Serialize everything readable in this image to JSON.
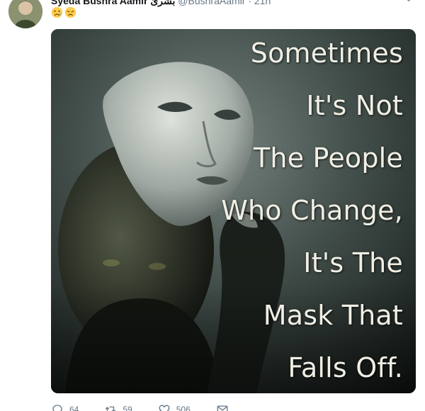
{
  "tweet": {
    "display_name": "Syeda Bushra Aamir بشریٰ",
    "handle": "@BushraAamir",
    "separator": "·",
    "time": "21h",
    "emojis": [
      "crying-face-emoji",
      "disappointed-face-emoji"
    ],
    "image_text": [
      "Sometimes",
      "It's Not",
      "The People",
      "Who Change,",
      "It's The",
      "Mask That",
      "Falls Off."
    ],
    "actions": {
      "replies": "64",
      "retweets": "59",
      "likes": "506"
    }
  },
  "colors": {
    "name": "#14171a",
    "secondary": "#657786",
    "image_text": "#f1efe4",
    "image_bg": "#2f3a37"
  }
}
